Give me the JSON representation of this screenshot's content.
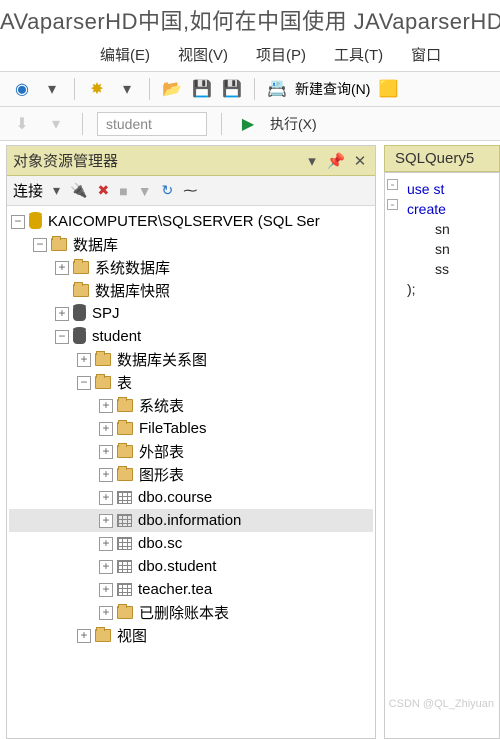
{
  "title": "AVaparserHD中国,如何在中国使用 JAVaparserHD?",
  "menu": {
    "edit": "编辑(E)",
    "view": "视图(V)",
    "project": "项目(P)",
    "tool": "工具(T)",
    "window": "窗口"
  },
  "toolbar": {
    "newquery": "新建查询(N)",
    "execute": "执行(X)"
  },
  "combo": {
    "db": "student"
  },
  "panel": {
    "title": "对象资源管理器",
    "connect": "连接"
  },
  "tab": {
    "title": "SQLQuery5"
  },
  "tree": {
    "server": "KAICOMPUTER\\SQLSERVER (SQL Ser",
    "databases": "数据库",
    "sysdb": "系统数据库",
    "snapshot": "数据库快照",
    "spj": "SPJ",
    "student": "student",
    "diagram": "数据库关系图",
    "tables": "表",
    "systables": "系统表",
    "filetables": "FileTables",
    "external": "外部表",
    "graph": "图形表",
    "t_course": "dbo.course",
    "t_info": "dbo.information",
    "t_sc": "dbo.sc",
    "t_student": "dbo.student",
    "t_teacher": "teacher.tea",
    "t_deleted": "已删除账本表",
    "views": "视图"
  },
  "code": {
    "l1": "use st",
    "l2": "create",
    "l3": "sn",
    "l4": "sn",
    "l5": "ss",
    "l6": ");"
  },
  "watermark": "CSDN @QL_Zhiyuan"
}
